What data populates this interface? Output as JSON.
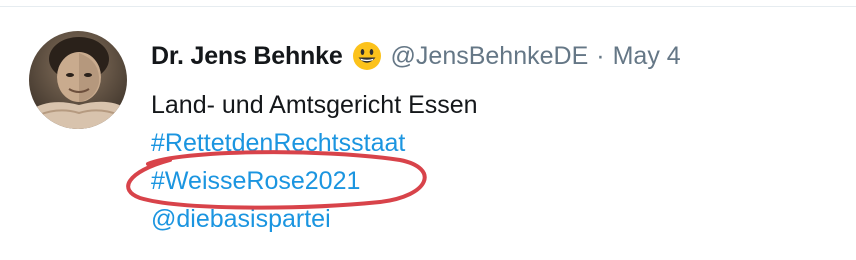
{
  "tweet": {
    "author": {
      "name": "Dr. Jens Behnke",
      "emoji": "grinning-face-emoji",
      "handle": "@JensBehnkeDE",
      "separator": "·"
    },
    "date": "May 4",
    "lines": [
      "Land- und Amtsgericht Essen",
      "#RettetdenRechtsstaat",
      "#WeisseRose2021",
      "@diebasispartei"
    ]
  },
  "annotation": {
    "shape": "hand-drawn-ellipse",
    "color": "#d8434a",
    "target": "#WeisseRose2021"
  },
  "colors": {
    "text_primary": "#14171a",
    "text_secondary": "#657786",
    "link": "#1b95e0"
  }
}
